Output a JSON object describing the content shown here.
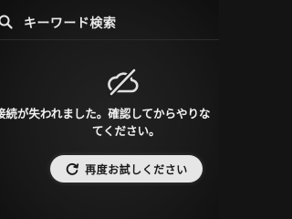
{
  "search": {
    "placeholder": "キーワード検索",
    "icon": "search-icon"
  },
  "error": {
    "icon": "cloud-off-icon",
    "line1": "接続が失われました。確認してからやりな",
    "line2": "てください。"
  },
  "retry": {
    "label": "再度お試しください",
    "icon": "refresh-icon"
  }
}
